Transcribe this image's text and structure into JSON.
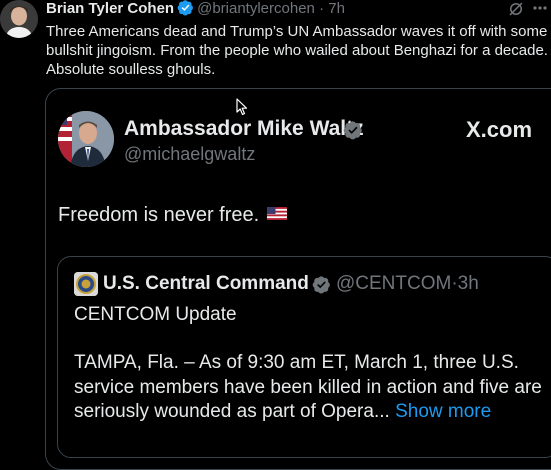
{
  "post": {
    "author_name": "Brian Tyler Cohen",
    "handle": "@briantylercohen",
    "separator": "·",
    "time": "7h",
    "text": "Three Americans dead and Trump’s UN Ambassador waves it off with some bullshit jingoism. From the people who wailed about Benghazi for a decade. Absolute soulless ghouls."
  },
  "embed": {
    "author_name": "Ambassador Mike Waltz",
    "handle": "@michaelgwaltz",
    "source": "X.com",
    "text": "Freedom is never free.",
    "flag_icon": "us-flag-icon"
  },
  "quote": {
    "author_name": "U.S. Central Command",
    "handle": "@CENTCOM",
    "separator": "·",
    "time": "3h",
    "title": "CENTCOM Update",
    "body": "TAMPA, Fla. – As of 9:30 am ET, March 1, three U.S. service members have been killed in action and five are seriously wounded as part of Opera...",
    "show_more": "Show more"
  },
  "colors": {
    "background": "#000000",
    "text": "#e7e9ea",
    "muted": "#71767b",
    "accent": "#1d9bf0",
    "border": "#38444d"
  }
}
